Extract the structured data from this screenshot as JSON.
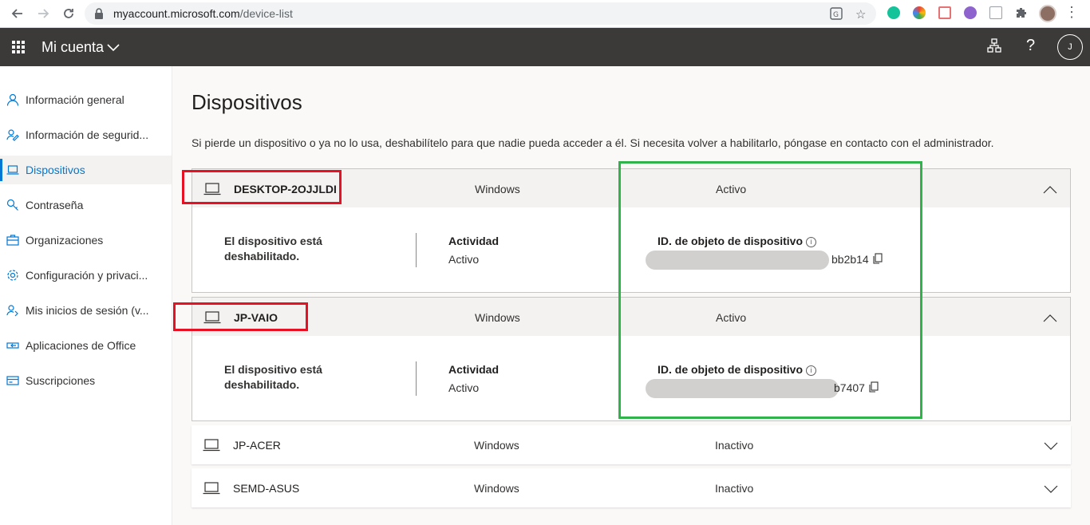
{
  "browser": {
    "url_host": "myaccount.microsoft.com",
    "url_path": "/device-list"
  },
  "appbar": {
    "title": "Mi cuenta",
    "avatar_initial": "J",
    "help_glyph": "?"
  },
  "sidebar": {
    "items": [
      {
        "label": "Información general",
        "icon": "person-icon",
        "active": false
      },
      {
        "label": "Información de segurid...",
        "icon": "security-info-icon",
        "active": false
      },
      {
        "label": "Dispositivos",
        "icon": "laptop-icon",
        "active": true
      },
      {
        "label": "Contraseña",
        "icon": "key-icon",
        "active": false
      },
      {
        "label": "Organizaciones",
        "icon": "briefcase-icon",
        "active": false
      },
      {
        "label": "Configuración y privaci...",
        "icon": "gear-icon",
        "active": false
      },
      {
        "label": "Mis inicios de sesión (v...",
        "icon": "sign-in-icon",
        "active": false
      },
      {
        "label": "Aplicaciones de Office",
        "icon": "office-apps-icon",
        "active": false
      },
      {
        "label": "Suscripciones",
        "icon": "subscriptions-icon",
        "active": false
      }
    ]
  },
  "main": {
    "title": "Dispositivos",
    "description": "Si pierde un dispositivo o ya no lo usa, deshabilítelo para que nadie pueda acceder a él. Si necesita volver a habilitarlo, póngase en contacto con el administrador.",
    "devices": [
      {
        "name": "DESKTOP-2OJJLDI",
        "os": "Windows",
        "status": "Activo",
        "expanded": true,
        "disabled_text": "El dispositivo está deshabilitado.",
        "activity_label": "Actividad",
        "activity_value": "Activo",
        "object_id_label": "ID. de objeto de dispositivo",
        "object_id_visible_suffix": "bb2b14"
      },
      {
        "name": "JP-VAIO",
        "os": "Windows",
        "status": "Activo",
        "expanded": true,
        "disabled_text": "El dispositivo está deshabilitado.",
        "activity_label": "Actividad",
        "activity_value": "Activo",
        "object_id_label": "ID. de objeto de dispositivo",
        "object_id_visible_suffix": "b7407"
      },
      {
        "name": "JP-ACER",
        "os": "Windows",
        "status": "Inactivo",
        "expanded": false
      },
      {
        "name": "SEMD-ASUS",
        "os": "Windows",
        "status": "Inactivo",
        "expanded": false
      }
    ]
  },
  "colors": {
    "appbar": "#3b3a39",
    "accent": "#0078d4",
    "annotation_red": "#e81123",
    "annotation_green": "#2fb34a"
  }
}
